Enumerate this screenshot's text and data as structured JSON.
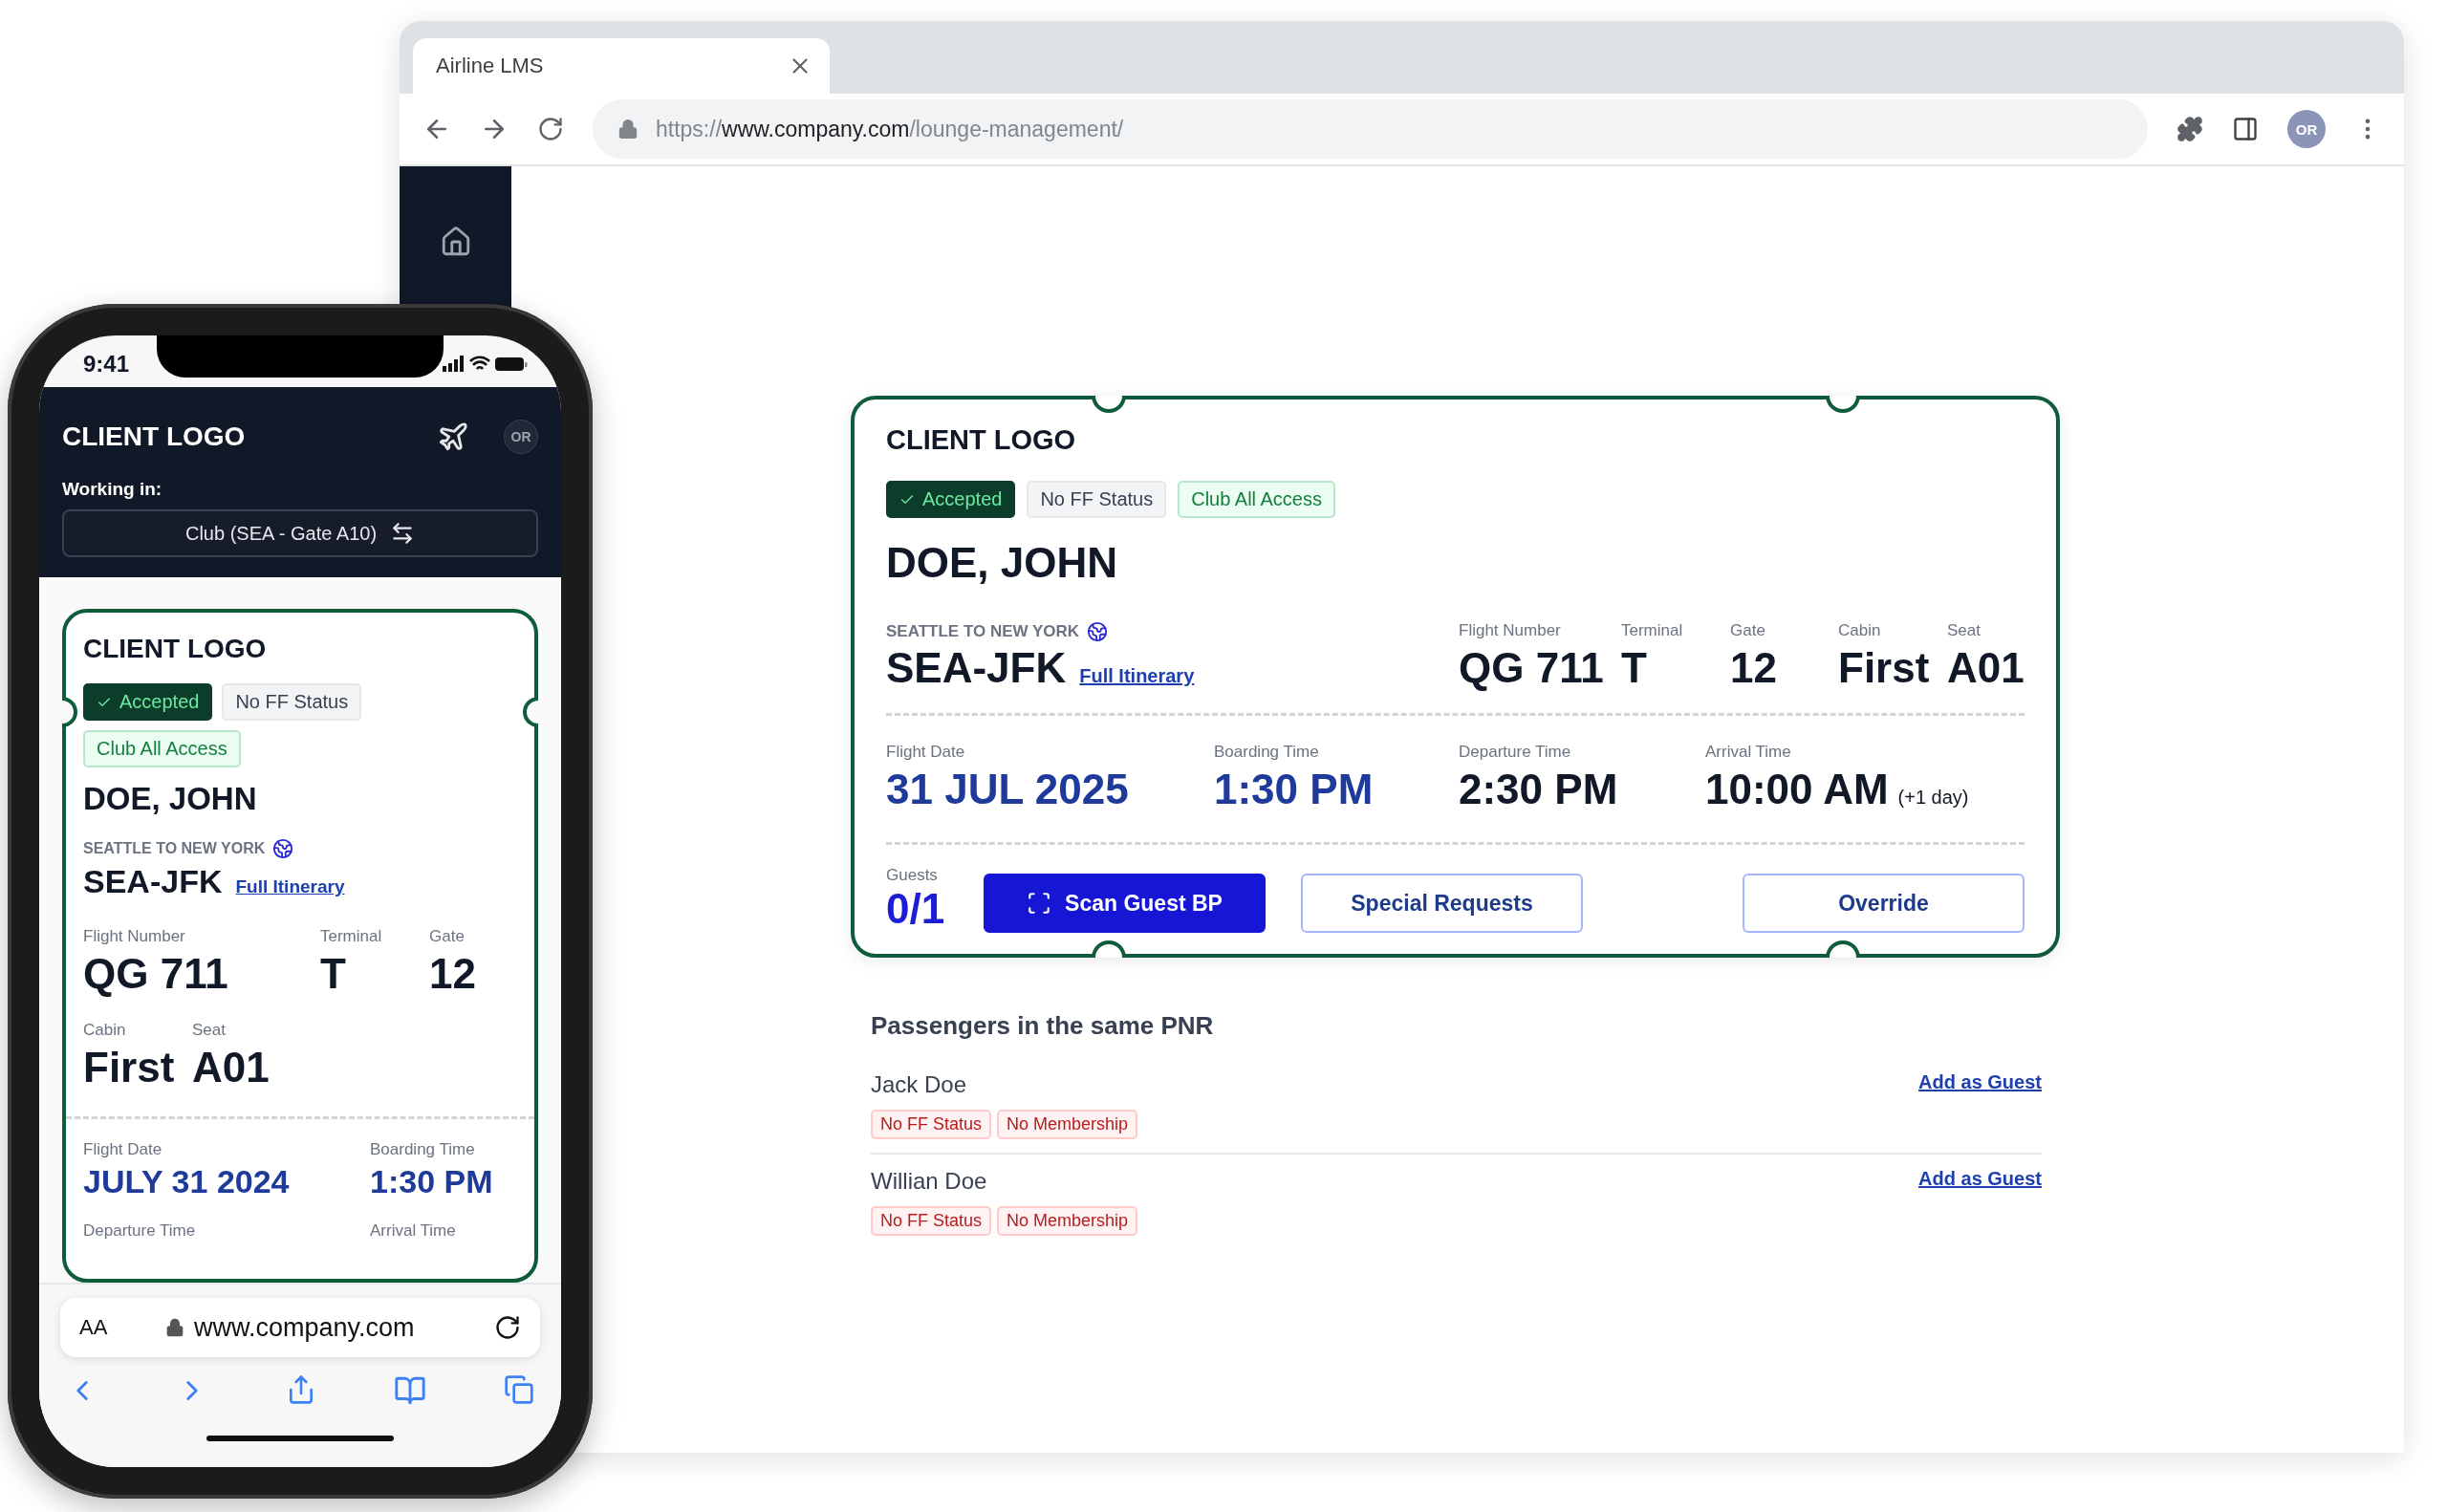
{
  "browser": {
    "tab_title": "Airline LMS",
    "url_scheme": "https://",
    "url_host": "www.company.com",
    "url_path": "/lounge-management/",
    "avatar": "OR"
  },
  "ticket": {
    "logo": "CLIENT LOGO",
    "badges": [
      {
        "label": "Accepted",
        "kind": "accepted"
      },
      {
        "label": "No FF Status",
        "kind": "neutral"
      },
      {
        "label": "Club All Access",
        "kind": "club"
      }
    ],
    "name": "DOE, JOHN",
    "route_label": "SEATTLE TO NEW YORK",
    "route": "SEA-JFK",
    "itinerary_link": "Full Itinerary",
    "details": [
      {
        "label": "Flight Number",
        "value": "QG 711"
      },
      {
        "label": "Terminal",
        "value": "T"
      },
      {
        "label": "Gate",
        "value": "12"
      },
      {
        "label": "Cabin",
        "value": "First"
      },
      {
        "label": "Seat",
        "value": "A01"
      }
    ],
    "times": [
      {
        "label": "Flight Date",
        "value": "31 JUL 2025",
        "kind": "highlight"
      },
      {
        "label": "Boarding Time",
        "value": "1:30 PM",
        "kind": "highlight"
      },
      {
        "label": "Departure Time",
        "value": "2:30 PM",
        "kind": "plain"
      },
      {
        "label": "Arrival Time",
        "value": "10:00 AM",
        "kind": "plain",
        "note": "(+1 day)"
      }
    ],
    "guests_label": "Guests",
    "guests": "0/1",
    "actions": [
      {
        "label": "Scan Guest BP",
        "kind": "primary"
      },
      {
        "label": "Special Requests",
        "kind": "outline"
      },
      {
        "label": "Override",
        "kind": "outline"
      }
    ]
  },
  "pnr": {
    "title": "Passengers in the same PNR",
    "passengers": [
      {
        "name": "Jack Doe",
        "tags": [
          "No FF Status",
          "No Membership"
        ],
        "action": "Add as Guest"
      },
      {
        "name": "Willian Doe",
        "tags": [
          "No FF Status",
          "No Membership"
        ],
        "action": "Add as Guest"
      }
    ]
  },
  "phone": {
    "time": "9:41",
    "logo": "CLIENT LOGO",
    "avatar": "OR",
    "working_label": "Working in:",
    "location": "Club (SEA - Gate A10)",
    "card": {
      "logo": "CLIENT LOGO",
      "badges": [
        {
          "label": "Accepted",
          "kind": "accepted"
        },
        {
          "label": "No FF Status",
          "kind": "neutral"
        },
        {
          "label": "Club All Access",
          "kind": "club"
        }
      ],
      "name": "DOE, JOHN",
      "route_label": "SEATTLE TO NEW YORK",
      "route": "SEA-JFK",
      "itinerary_link": "Full Itinerary",
      "detail_rows": [
        [
          {
            "label": "Flight Number",
            "value": "QG 711"
          },
          {
            "label": "Terminal",
            "value": "T"
          },
          {
            "label": "Gate",
            "value": "12"
          }
        ],
        [
          {
            "label": "Cabin",
            "value": "First"
          },
          {
            "label": "Seat",
            "value": "A01"
          }
        ]
      ],
      "times": [
        {
          "label": "Flight Date",
          "value": "JULY 31 2024",
          "kind": "highlight"
        },
        {
          "label": "Boarding Time",
          "value": "1:30 PM",
          "kind": "highlight"
        }
      ],
      "more_labels": [
        "Departure Time",
        "Arrival Time"
      ]
    },
    "text_size": "AA",
    "url": "www.company.com"
  }
}
